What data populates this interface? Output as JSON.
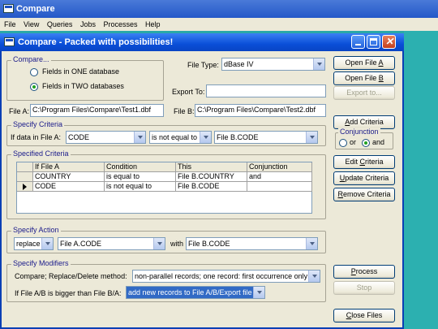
{
  "app": {
    "title": "Compare"
  },
  "menu": [
    "File",
    "View",
    "Queries",
    "Jobs",
    "Processes",
    "Help"
  ],
  "child_window": {
    "title": "Compare - Packed with possibilities!"
  },
  "compare_group": {
    "label": "Compare...",
    "option_one": "Fields in ONE database",
    "option_two": "Fields in TWO databases",
    "selected": "option_two"
  },
  "file_type": {
    "label": "File Type:",
    "value": "dBase IV"
  },
  "export_to": {
    "label": "Export To:",
    "value": ""
  },
  "file_a": {
    "label": "File A:",
    "value": "C:\\Program Files\\Compare\\Test1.dbf"
  },
  "file_b": {
    "label": "File B:",
    "value": "C:\\Program Files\\Compare\\Test2.dbf"
  },
  "buttons": {
    "open_a_pre": "Open File ",
    "open_a_key": "A",
    "open_b_pre": "Open File ",
    "open_b_key": "B",
    "export_to_label": "Export to...",
    "add_key": "A",
    "add_rest": "dd Criteria",
    "edit_pre": "Edit ",
    "edit_key": "C",
    "edit_rest": "riteria",
    "update_key": "U",
    "update_rest": "pdate Criteria",
    "remove_key": "R",
    "remove_rest": "emove Criteria",
    "process_key": "P",
    "process_rest": "rocess",
    "stop_label": "Stop",
    "close_key": "C",
    "close_rest": "lose Files"
  },
  "specify_criteria": {
    "label": "Specify Criteria",
    "prefix": "If data in File A:",
    "field": "CODE",
    "operator": "is not equal to",
    "target": "File B.CODE"
  },
  "conjunction": {
    "label": "Conjunction",
    "or": "or",
    "and": "and",
    "selected": "and"
  },
  "specified_criteria": {
    "label": "Specified Criteria",
    "columns": [
      "If File A",
      "Condition",
      "This",
      "Conjunction"
    ],
    "rows": [
      [
        "COUNTRY",
        "is equal to",
        "File B.COUNTRY",
        "and"
      ],
      [
        "CODE",
        "is not equal to",
        "File B.CODE",
        ""
      ]
    ],
    "current_row": 1
  },
  "specify_action": {
    "label": "Specify Action",
    "action": "replace",
    "field": "File A.CODE",
    "with_label": "with",
    "with_value": "File B.CODE"
  },
  "specify_modifiers": {
    "label": "Specify Modifiers",
    "method_label": "Compare; Replace/Delete method:",
    "method_value": "non-parallel records; one record: first occurrence only",
    "bigger_label": "If File A/B is bigger than File B/A:",
    "bigger_value": "add new records to File A/B/Export file"
  },
  "colors": {
    "title_bar": "#0a4fd8",
    "teal_background": "#2cb0b0",
    "selection": "#316ac5"
  }
}
